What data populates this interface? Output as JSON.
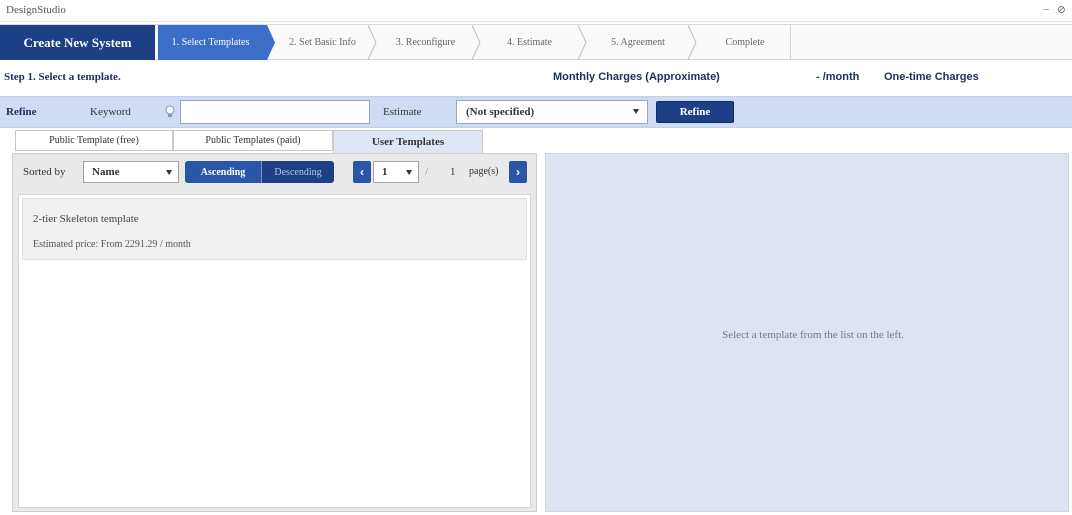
{
  "app": {
    "title": "DesignStudio",
    "controls": [
      "–",
      "⊘"
    ]
  },
  "wizard": {
    "create_label": "Create New System",
    "steps": [
      {
        "label": "1. Select Templates",
        "active": true
      },
      {
        "label": "2. Set Basic Info",
        "active": false
      },
      {
        "label": "3. Reconfigure",
        "active": false
      },
      {
        "label": "4. Estimate",
        "active": false
      },
      {
        "label": "5. Agreement",
        "active": false
      },
      {
        "label": "Complete",
        "active": false
      }
    ]
  },
  "stepline": {
    "title": "Step 1. Select a template.",
    "monthly_label": "Monthly Charges (Approximate)",
    "monthly_value": "- /month",
    "onetime_label": "One-time Charges"
  },
  "refine": {
    "label": "Refine",
    "keyword_label": "Keyword",
    "keyword_value": "",
    "estimate_label": "Estimate",
    "estimate_value": "(Not specified)",
    "button_label": "Refine"
  },
  "tabs": [
    {
      "label": "Public Template (free)",
      "active": false
    },
    {
      "label": "Public Templates (paid)",
      "active": false
    },
    {
      "label": "User Templates",
      "active": true
    }
  ],
  "list_toolbar": {
    "sort_label": "Sorted by",
    "sort_value": "Name",
    "ascending": "Ascending",
    "descending": "Descending",
    "page_value": "1",
    "page_slash": "/",
    "page_total": "1",
    "page_label": "page(s)"
  },
  "templates": [
    {
      "name": "2-tier Skeleton template",
      "price": "Estimated price: From 2291.29 / month"
    }
  ],
  "detail": {
    "empty_message": "Select a template from the list on the left."
  },
  "colors": {
    "brand_navy": "#1c3f86",
    "active_step": "#3b6fc7",
    "refine_bar": "#d0dcf3",
    "detail_bg": "#dde3f0"
  }
}
